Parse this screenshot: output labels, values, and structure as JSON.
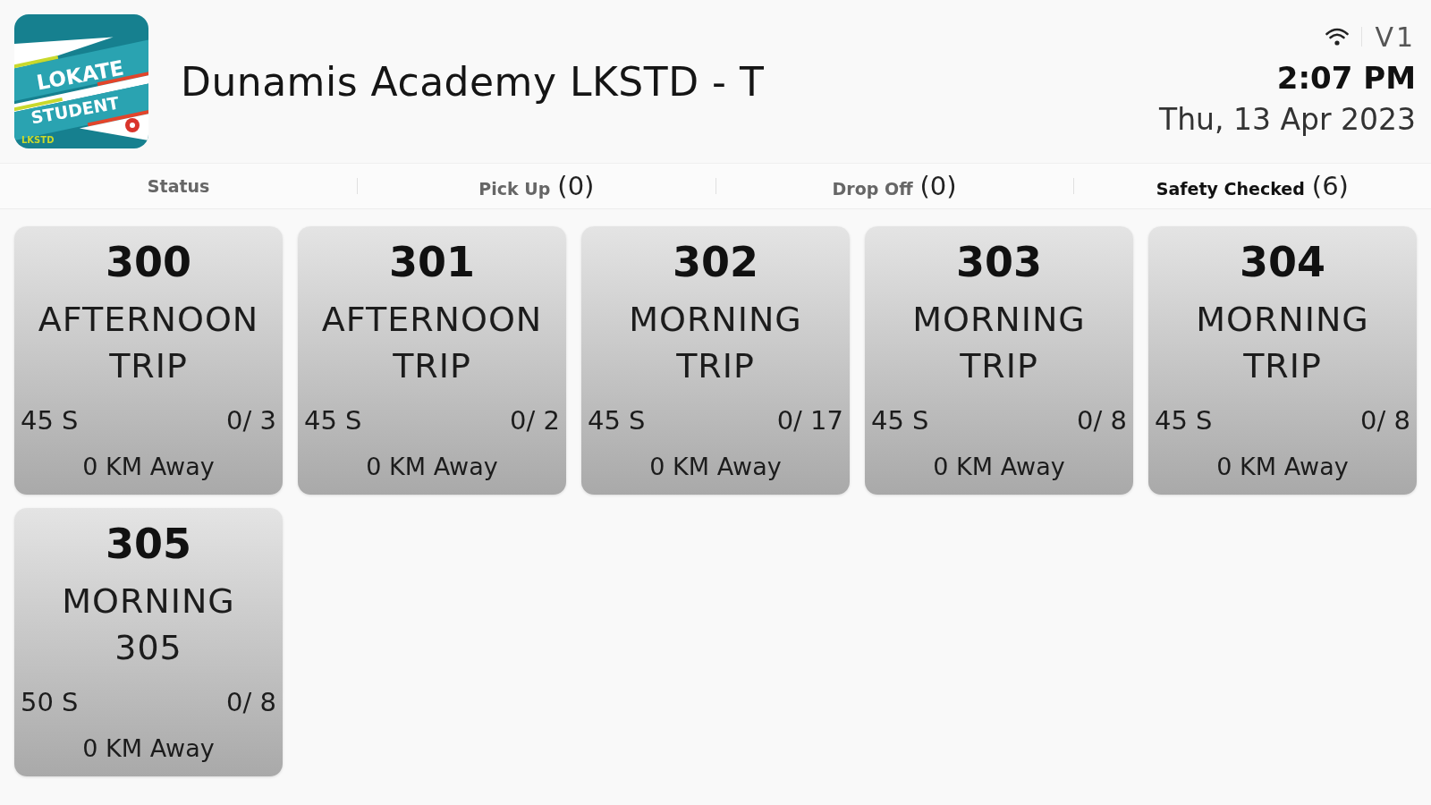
{
  "header": {
    "logo": {
      "line_1": "LOKATE",
      "line_2": "STUDENT",
      "line_3": "LKSTD"
    },
    "title": "Dunamis Academy LKSTD - T",
    "version": "V1",
    "time": "2:07 PM",
    "date": "Thu, 13 Apr 2023"
  },
  "tabs": [
    {
      "label": "Status",
      "selected": false
    },
    {
      "label": "Pick Up",
      "count": "(0)",
      "selected": false
    },
    {
      "label": "Drop Off",
      "count": "(0)",
      "selected": false
    },
    {
      "label": "Safety Checked",
      "count": "(6)",
      "selected": true
    }
  ],
  "trips": [
    {
      "number": "300",
      "name": "AFTERNOON TRIP",
      "duration": "45 S",
      "count": "0/ 3",
      "distance": "0 KM Away"
    },
    {
      "number": "301",
      "name": "AFTERNOON TRIP",
      "duration": "45 S",
      "count": "0/ 2",
      "distance": "0 KM Away"
    },
    {
      "number": "302",
      "name": "MORNING TRIP",
      "duration": "45 S",
      "count": "0/ 17",
      "distance": "0 KM Away"
    },
    {
      "number": "303",
      "name": "MORNING TRIP",
      "duration": "45 S",
      "count": "0/ 8",
      "distance": "0 KM Away"
    },
    {
      "number": "304",
      "name": "MORNING TRIP",
      "duration": "45 S",
      "count": "0/ 8",
      "distance": "0 KM Away"
    },
    {
      "number": "305",
      "name": "MORNING 305",
      "duration": "50 S",
      "count": "0/ 8",
      "distance": "0 KM Away"
    }
  ]
}
